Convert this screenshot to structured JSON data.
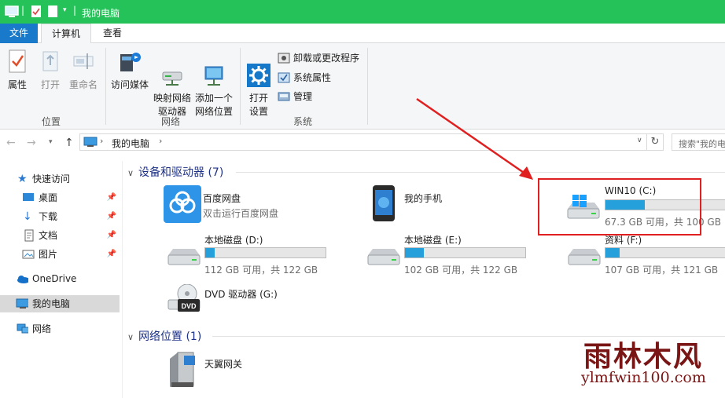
{
  "window": {
    "title": "我的电脑"
  },
  "tabs": {
    "file": "文件",
    "computer": "计算机",
    "view": "查看"
  },
  "ribbon": {
    "location_group": {
      "label": "位置",
      "properties": "属性",
      "open": "打开",
      "rename": "重命名"
    },
    "network_group": {
      "label": "网络",
      "access_media": "访问媒体",
      "map_drive": "映射网络\n驱动器",
      "add_location": "添加一个\n网络位置"
    },
    "system_group": {
      "label": "系统",
      "open_settings": "打开\n设置",
      "uninstall": "卸载或更改程序",
      "sys_properties": "系统属性",
      "manage": "管理"
    }
  },
  "address": {
    "crumb": "我的电脑",
    "search_placeholder": "搜索\"我的电"
  },
  "nav": {
    "quick_access": "快速访问",
    "desktop": "桌面",
    "downloads": "下载",
    "documents": "文档",
    "pictures": "图片",
    "onedrive": "OneDrive",
    "this_pc": "我的电脑",
    "network": "网络"
  },
  "content": {
    "devices_header": "设备和驱动器 (7)",
    "network_header": "网络位置 (1)",
    "baidu": {
      "name": "百度网盘",
      "sub": "双击运行百度网盘"
    },
    "phone": {
      "name": "我的手机"
    },
    "drive_c": {
      "name": "WIN10 (C:)",
      "free": "67.3 GB 可用，共 100 GB",
      "used_fraction": 0.33
    },
    "drive_d": {
      "name": "本地磁盘 (D:)",
      "free": "112 GB 可用，共 122 GB",
      "used_fraction": 0.08
    },
    "drive_e": {
      "name": "本地磁盘 (E:)",
      "free": "102 GB 可用，共 122 GB",
      "used_fraction": 0.16
    },
    "drive_f": {
      "name": "资料 (F:)",
      "free": "107 GB 可用，共 121 GB",
      "used_fraction": 0.12
    },
    "dvd": {
      "name": "DVD 驱动器 (G:)",
      "badge": "DVD"
    },
    "tianyi": {
      "name": "天翼网关"
    }
  },
  "watermark": {
    "brand": "雨林木风",
    "url": "ylmfwin100.com"
  },
  "colors": {
    "titlebar": "#25c25a",
    "file_tab": "#1979ca",
    "drive_bar": "#26a0da",
    "annotation": "#e02020"
  }
}
